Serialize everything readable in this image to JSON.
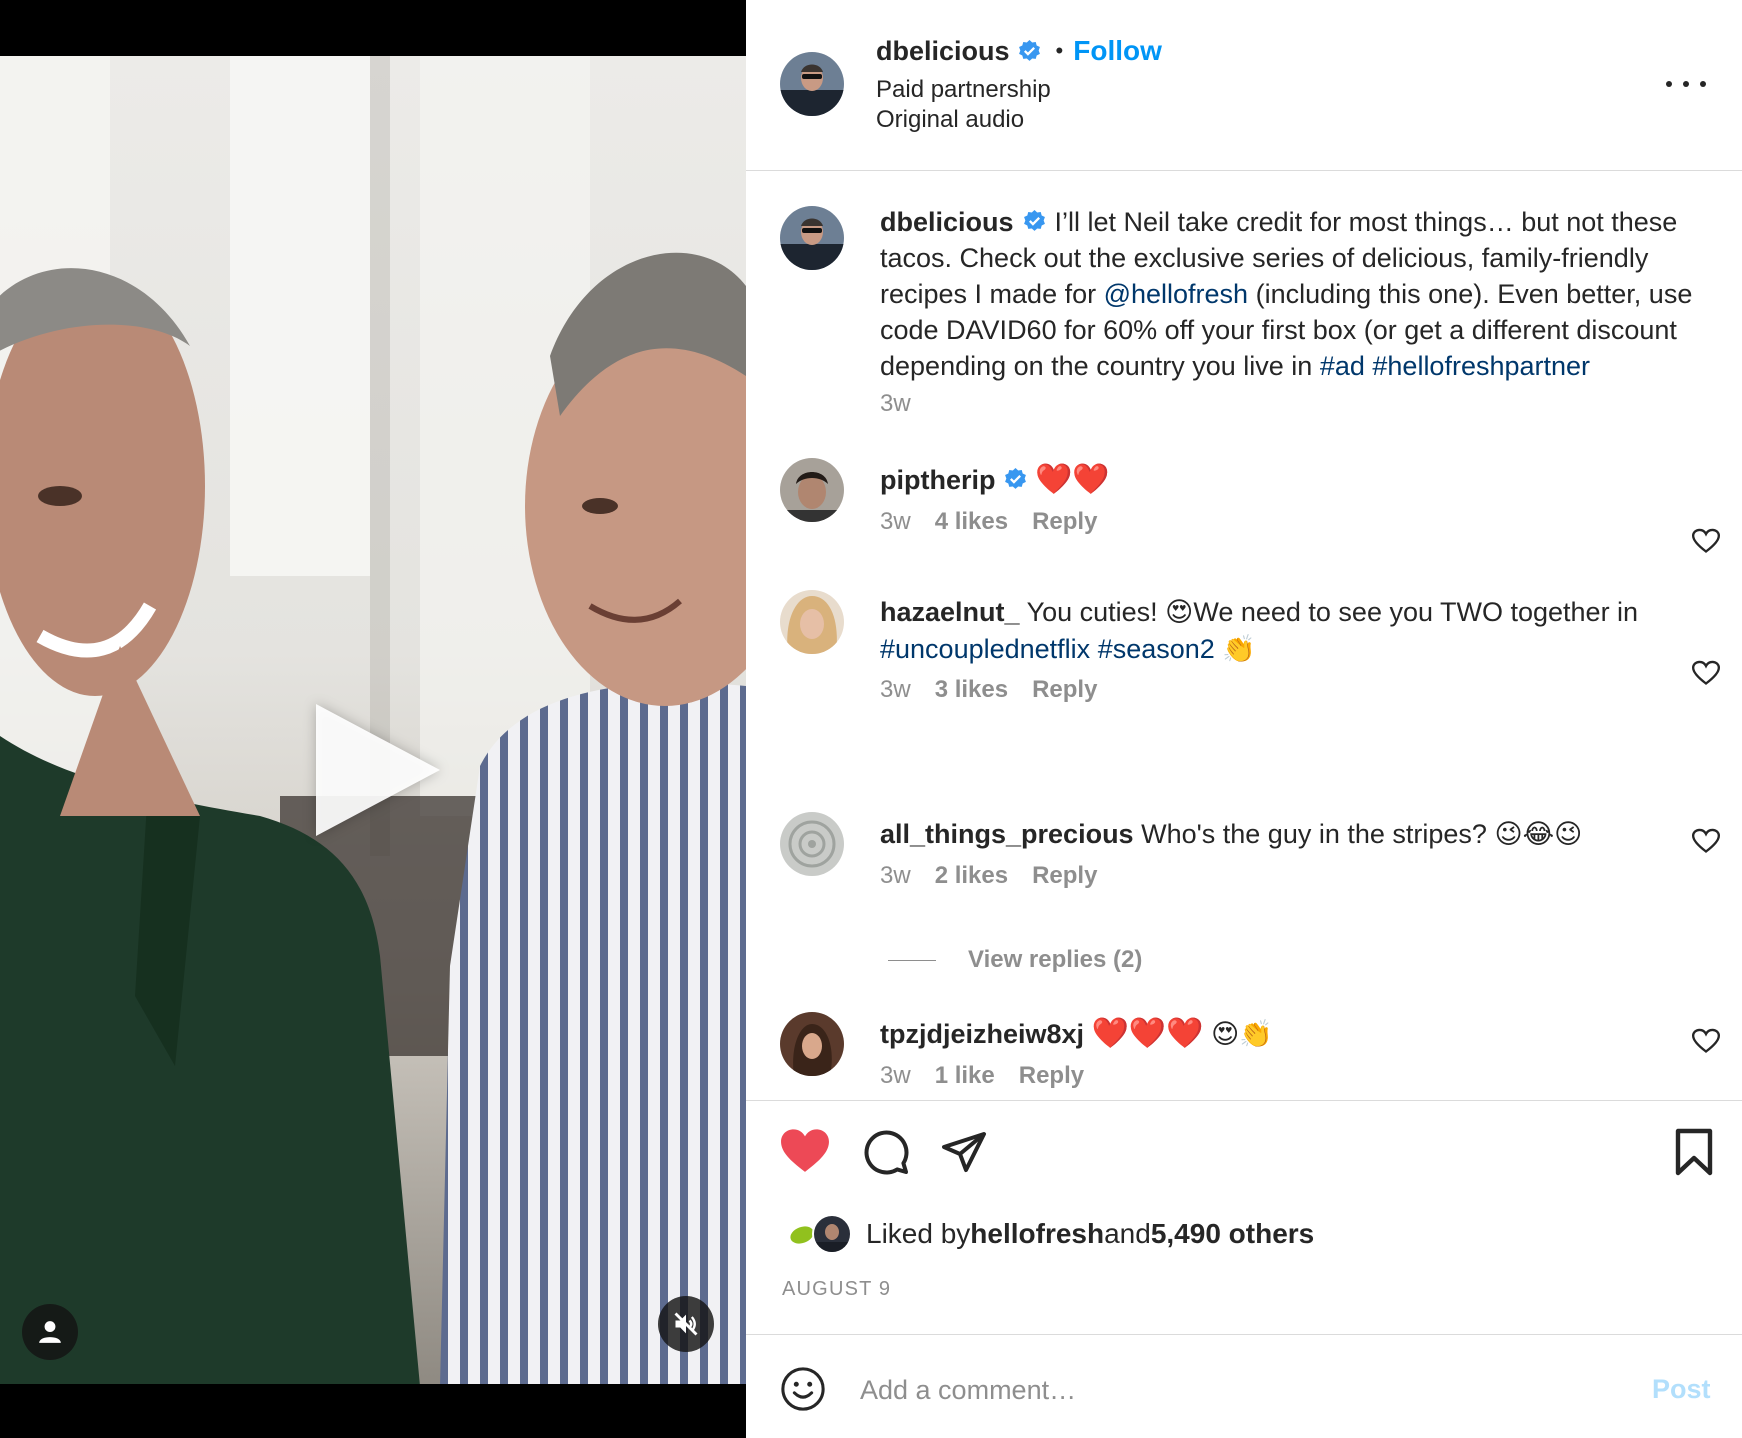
{
  "post": {
    "username": "dbelicious",
    "follow_label": "Follow",
    "dot": "•",
    "paid_partnership": "Paid partnership",
    "audio": "Original audio"
  },
  "caption": {
    "username": "dbelicious",
    "text_1": "I’ll let Neil take credit for most things… but not these tacos. Check out the exclusive series of delicious, family-friendly recipes I made for ",
    "mention": "@hellofresh",
    "text_2": " (including this one). Even better, use code DAVID60 for 60% off your first box (or get a different discount depending on the country you live in ",
    "hashtag_1": "#ad",
    "hashtag_2": "#hellofreshpartner",
    "time": "3w"
  },
  "comments": [
    {
      "username": "piptherip",
      "verified": true,
      "text": "",
      "emoji": "❤️❤️",
      "time": "3w",
      "likes": "4 likes",
      "reply": "Reply"
    },
    {
      "username": "hazaelnut_",
      "text_1": "You cuties! ",
      "emoji_1": "😍",
      "text_2": "We need to see you TWO together in ",
      "hashtag_1": "#uncouplednetflix",
      "hashtag_2": "#season2",
      "emoji_2": "👏",
      "time": "3w",
      "likes": "3 likes",
      "reply": "Reply"
    },
    {
      "username": "all_things_precious",
      "text": "Who's the guy in the stripes? ",
      "emoji": "😉😂😉",
      "time": "3w",
      "likes": "2 likes",
      "reply": "Reply"
    },
    {
      "username": "tpzjdjeizheiw8xj",
      "emoji_1": "❤️❤️❤️",
      "emoji_2": "😍👏",
      "time": "3w",
      "likes": "1 like",
      "reply": "Reply"
    }
  ],
  "view_replies": "View replies (2)",
  "likes": {
    "prefix": "Liked by ",
    "user": "hellofresh",
    "middle": " and ",
    "count": "5,490 others"
  },
  "date": "AUGUST 9",
  "composer": {
    "placeholder": "Add a comment…",
    "post_label": "Post"
  },
  "icons": {
    "verified": "verified-badge-icon",
    "like_active": "heart-filled-icon",
    "comment": "comment-bubble-icon",
    "share": "paper-plane-icon",
    "save": "bookmark-icon",
    "emoji": "smiley-icon",
    "mute": "speaker-muted-icon",
    "tagged": "person-icon",
    "play": "play-icon"
  },
  "colors": {
    "accent": "#0095f6",
    "link": "#00376b",
    "like_red": "#ed4956",
    "muted_text": "#8e8e8e"
  }
}
